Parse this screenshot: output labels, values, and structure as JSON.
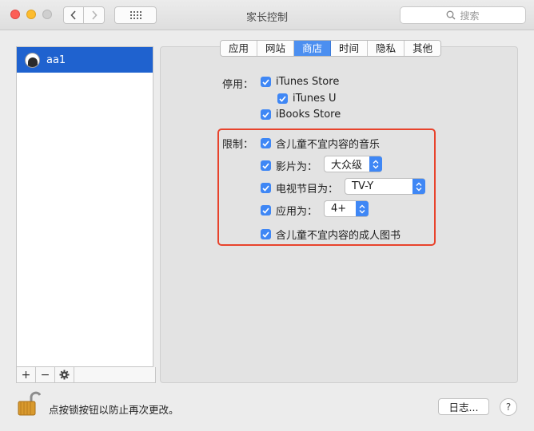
{
  "window": {
    "title": "家长控制"
  },
  "search": {
    "placeholder": "搜索"
  },
  "sidebar": {
    "users": [
      {
        "name": "aa1"
      }
    ]
  },
  "tabs": [
    {
      "label": "应用"
    },
    {
      "label": "网站"
    },
    {
      "label": "商店",
      "active": true
    },
    {
      "label": "时间"
    },
    {
      "label": "隐私"
    },
    {
      "label": "其他"
    }
  ],
  "disable": {
    "label": "停用：",
    "items": [
      {
        "label": "iTunes Store",
        "checked": true
      },
      {
        "label": "iTunes U",
        "checked": true
      },
      {
        "label": "iBooks Store",
        "checked": true
      }
    ]
  },
  "restrict": {
    "label": "限制：",
    "explicit_music": {
      "label": "含儿童不宜内容的音乐",
      "checked": true
    },
    "movies": {
      "label": "影片为：",
      "checked": true,
      "value": "大众级"
    },
    "tv": {
      "label": "电视节目为：",
      "checked": true,
      "value": "TV-Y"
    },
    "apps": {
      "label": "应用为：",
      "checked": true,
      "value": "4+"
    },
    "explicit_books": {
      "label": "含儿童不宜内容的成人图书",
      "checked": true
    }
  },
  "footer": {
    "lock_text": "点按锁按钮以防止再次更改。",
    "log_button": "日志...",
    "help": "?"
  },
  "colors": {
    "accent": "#3f87f5",
    "highlight_border": "#e8432c",
    "selection": "#1f62cf"
  }
}
